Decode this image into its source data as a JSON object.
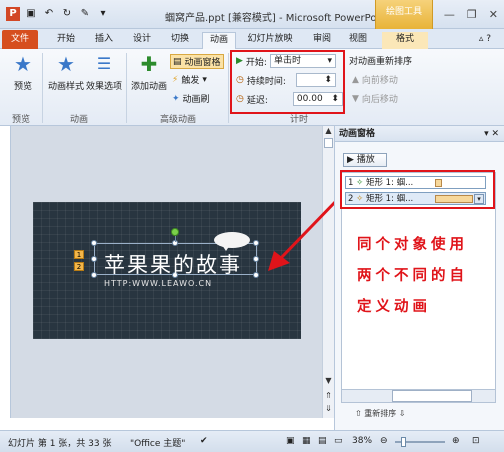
{
  "window": {
    "title": "蝈窝产品.ppt [兼容模式] - Microsoft PowerPoint",
    "context_tab_group": "绘图工具"
  },
  "tabs": [
    "文件",
    "开始",
    "插入",
    "设计",
    "切换",
    "动画",
    "幻灯片放映",
    "审阅",
    "视图",
    "格式"
  ],
  "ribbon": {
    "preview": "预览",
    "preview_group": "预览",
    "anim_styles": "动画样式",
    "effect_options": "效果选项",
    "animation_group": "动画",
    "add_animation": "添加动画",
    "anim_pane_btn": "动画窗格",
    "trigger": "触发",
    "anim_painter": "动画刷",
    "advanced_group": "高级动画",
    "start_label": "开始:",
    "start_value": "单击时",
    "duration_label": "持续时间:",
    "delay_label": "延迟:",
    "delay_value": "00.00",
    "reorder_title": "对动画重新排序",
    "move_earlier": "向前移动",
    "move_later": "向后移动",
    "timing_group": "计时"
  },
  "slide": {
    "title": "苹果果的故事",
    "url": "HTTP:WWW.LEAWO.CN",
    "tag1": "1",
    "tag2": "2"
  },
  "anim_pane": {
    "title": "动画窗格",
    "play": "播放",
    "items": [
      {
        "index": "1",
        "label": "矩形 1: 蝈..."
      },
      {
        "index": "2",
        "label": "矩形 1: 蝈..."
      }
    ],
    "reorder_label": "重新排序"
  },
  "annotation": {
    "line1": "同个对象使用",
    "line2": "两个不同的自",
    "line3": "定义动画"
  },
  "statusbar": {
    "slide_info": "幻灯片 第 1 张，共 33 张",
    "theme": "\"Office 主题\"",
    "zoom": "38%"
  }
}
